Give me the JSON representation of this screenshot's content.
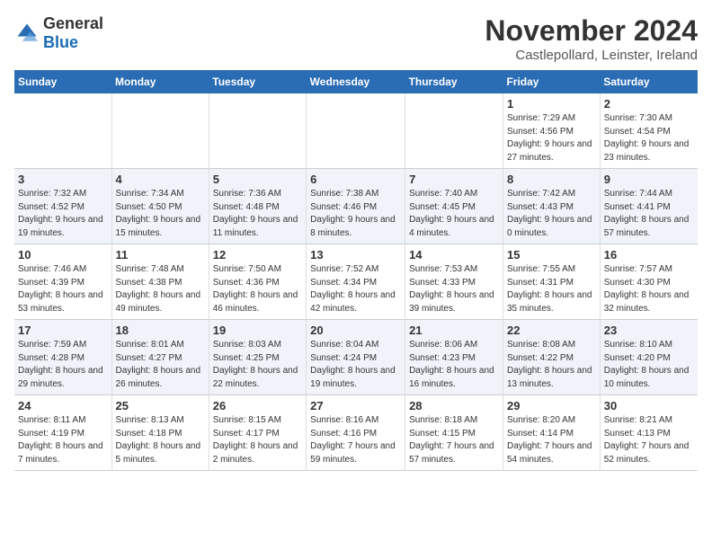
{
  "logo": {
    "text_general": "General",
    "text_blue": "Blue"
  },
  "title": "November 2024",
  "location": "Castlepollard, Leinster, Ireland",
  "days_header": [
    "Sunday",
    "Monday",
    "Tuesday",
    "Wednesday",
    "Thursday",
    "Friday",
    "Saturday"
  ],
  "weeks": [
    [
      {
        "day": "",
        "info": ""
      },
      {
        "day": "",
        "info": ""
      },
      {
        "day": "",
        "info": ""
      },
      {
        "day": "",
        "info": ""
      },
      {
        "day": "",
        "info": ""
      },
      {
        "day": "1",
        "info": "Sunrise: 7:29 AM\nSunset: 4:56 PM\nDaylight: 9 hours and 27 minutes."
      },
      {
        "day": "2",
        "info": "Sunrise: 7:30 AM\nSunset: 4:54 PM\nDaylight: 9 hours and 23 minutes."
      }
    ],
    [
      {
        "day": "3",
        "info": "Sunrise: 7:32 AM\nSunset: 4:52 PM\nDaylight: 9 hours and 19 minutes."
      },
      {
        "day": "4",
        "info": "Sunrise: 7:34 AM\nSunset: 4:50 PM\nDaylight: 9 hours and 15 minutes."
      },
      {
        "day": "5",
        "info": "Sunrise: 7:36 AM\nSunset: 4:48 PM\nDaylight: 9 hours and 11 minutes."
      },
      {
        "day": "6",
        "info": "Sunrise: 7:38 AM\nSunset: 4:46 PM\nDaylight: 9 hours and 8 minutes."
      },
      {
        "day": "7",
        "info": "Sunrise: 7:40 AM\nSunset: 4:45 PM\nDaylight: 9 hours and 4 minutes."
      },
      {
        "day": "8",
        "info": "Sunrise: 7:42 AM\nSunset: 4:43 PM\nDaylight: 9 hours and 0 minutes."
      },
      {
        "day": "9",
        "info": "Sunrise: 7:44 AM\nSunset: 4:41 PM\nDaylight: 8 hours and 57 minutes."
      }
    ],
    [
      {
        "day": "10",
        "info": "Sunrise: 7:46 AM\nSunset: 4:39 PM\nDaylight: 8 hours and 53 minutes."
      },
      {
        "day": "11",
        "info": "Sunrise: 7:48 AM\nSunset: 4:38 PM\nDaylight: 8 hours and 49 minutes."
      },
      {
        "day": "12",
        "info": "Sunrise: 7:50 AM\nSunset: 4:36 PM\nDaylight: 8 hours and 46 minutes."
      },
      {
        "day": "13",
        "info": "Sunrise: 7:52 AM\nSunset: 4:34 PM\nDaylight: 8 hours and 42 minutes."
      },
      {
        "day": "14",
        "info": "Sunrise: 7:53 AM\nSunset: 4:33 PM\nDaylight: 8 hours and 39 minutes."
      },
      {
        "day": "15",
        "info": "Sunrise: 7:55 AM\nSunset: 4:31 PM\nDaylight: 8 hours and 35 minutes."
      },
      {
        "day": "16",
        "info": "Sunrise: 7:57 AM\nSunset: 4:30 PM\nDaylight: 8 hours and 32 minutes."
      }
    ],
    [
      {
        "day": "17",
        "info": "Sunrise: 7:59 AM\nSunset: 4:28 PM\nDaylight: 8 hours and 29 minutes."
      },
      {
        "day": "18",
        "info": "Sunrise: 8:01 AM\nSunset: 4:27 PM\nDaylight: 8 hours and 26 minutes."
      },
      {
        "day": "19",
        "info": "Sunrise: 8:03 AM\nSunset: 4:25 PM\nDaylight: 8 hours and 22 minutes."
      },
      {
        "day": "20",
        "info": "Sunrise: 8:04 AM\nSunset: 4:24 PM\nDaylight: 8 hours and 19 minutes."
      },
      {
        "day": "21",
        "info": "Sunrise: 8:06 AM\nSunset: 4:23 PM\nDaylight: 8 hours and 16 minutes."
      },
      {
        "day": "22",
        "info": "Sunrise: 8:08 AM\nSunset: 4:22 PM\nDaylight: 8 hours and 13 minutes."
      },
      {
        "day": "23",
        "info": "Sunrise: 8:10 AM\nSunset: 4:20 PM\nDaylight: 8 hours and 10 minutes."
      }
    ],
    [
      {
        "day": "24",
        "info": "Sunrise: 8:11 AM\nSunset: 4:19 PM\nDaylight: 8 hours and 7 minutes."
      },
      {
        "day": "25",
        "info": "Sunrise: 8:13 AM\nSunset: 4:18 PM\nDaylight: 8 hours and 5 minutes."
      },
      {
        "day": "26",
        "info": "Sunrise: 8:15 AM\nSunset: 4:17 PM\nDaylight: 8 hours and 2 minutes."
      },
      {
        "day": "27",
        "info": "Sunrise: 8:16 AM\nSunset: 4:16 PM\nDaylight: 7 hours and 59 minutes."
      },
      {
        "day": "28",
        "info": "Sunrise: 8:18 AM\nSunset: 4:15 PM\nDaylight: 7 hours and 57 minutes."
      },
      {
        "day": "29",
        "info": "Sunrise: 8:20 AM\nSunset: 4:14 PM\nDaylight: 7 hours and 54 minutes."
      },
      {
        "day": "30",
        "info": "Sunrise: 8:21 AM\nSunset: 4:13 PM\nDaylight: 7 hours and 52 minutes."
      }
    ]
  ]
}
